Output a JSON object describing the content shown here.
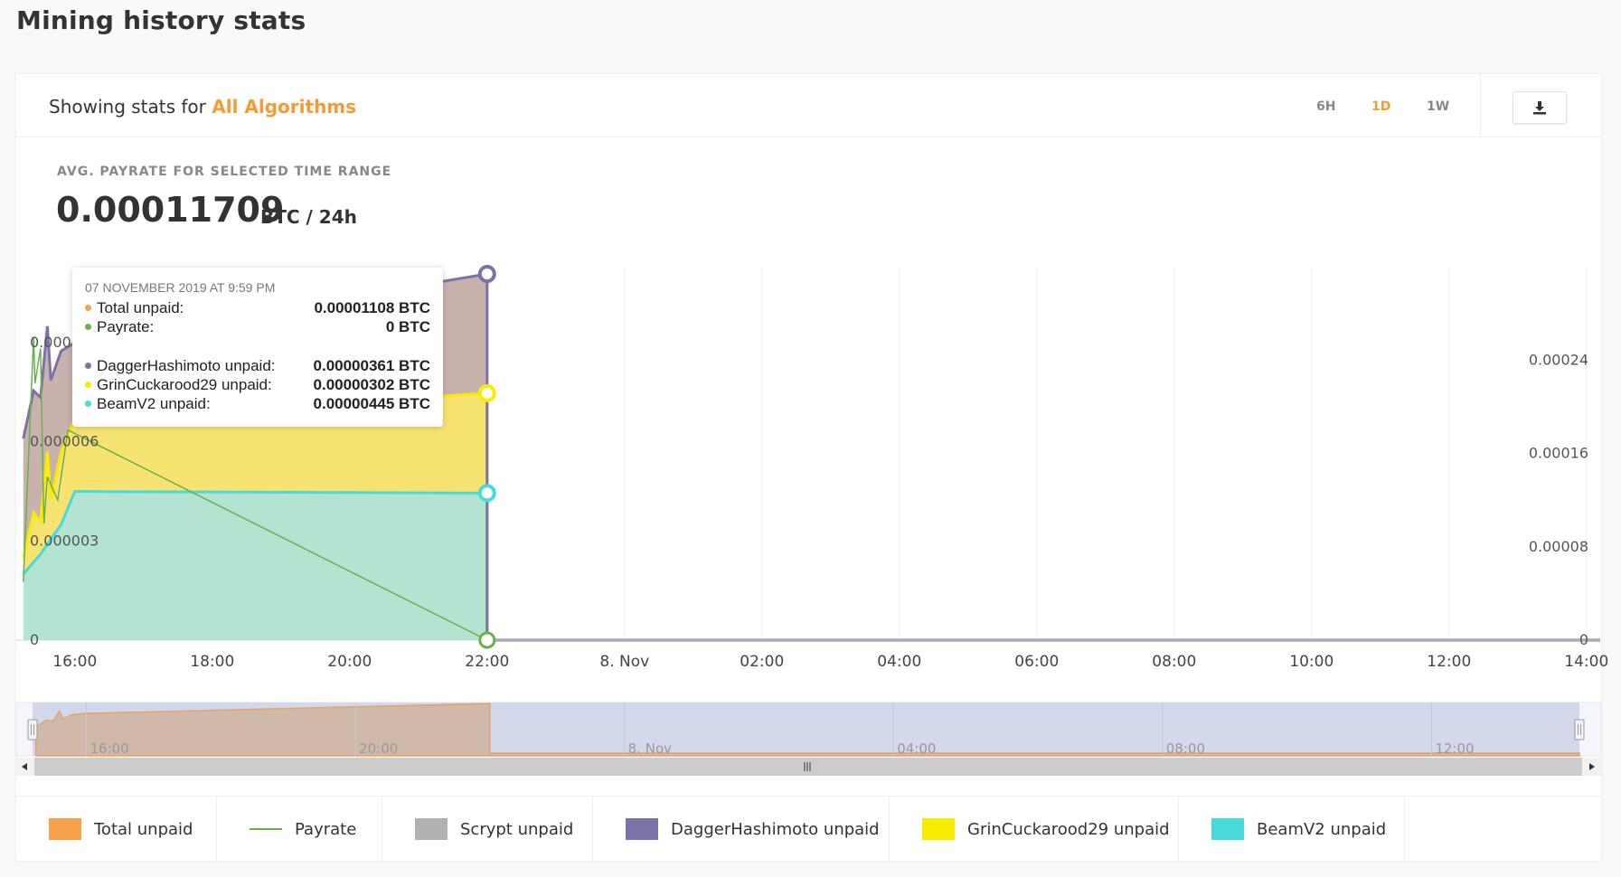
{
  "page": {
    "title": "Mining history stats"
  },
  "header": {
    "showing_prefix": "Showing stats for",
    "algorithm": "All Algorithms",
    "ranges": [
      "6H",
      "1D",
      "1W"
    ],
    "active_range": "1D",
    "download_icon": "download-icon"
  },
  "summary": {
    "label": "AVG. PAYRATE FOR SELECTED TIME RANGE",
    "value": "0.00011709",
    "unit": "BTC / 24h"
  },
  "colors": {
    "accent": "#f39c34",
    "total_unpaid": "#f7a24b",
    "payrate": "#6ab04c",
    "scrypt": "#b1b1b1",
    "dagger": "#7b73a8",
    "grin": "#f8ec00",
    "beam": "#4bd9d9",
    "dagger_fill": "#c9b1ae",
    "grin_fill": "#f7e372",
    "beam_fill": "#b3e4d2"
  },
  "tooltip": {
    "date": "07 NOVEMBER 2019 AT 9:59 PM",
    "rows": [
      {
        "label": "Total unpaid:",
        "value": "0.00001108 BTC",
        "color": "#f7a24b"
      },
      {
        "label": "Payrate:",
        "value": "0 BTC",
        "color": "#6ab04c"
      }
    ],
    "algo_rows": [
      {
        "label": "DaggerHashimoto unpaid:",
        "value": "0.00000361 BTC",
        "color": "#7b73a8"
      },
      {
        "label": "GrinCuckarood29 unpaid:",
        "value": "0.00000302 BTC",
        "color": "#f8ec00"
      },
      {
        "label": "BeamV2 unpaid:",
        "value": "0.00000445 BTC",
        "color": "#4bd9d9"
      }
    ]
  },
  "chart_data": {
    "type": "area",
    "x_tick_labels": [
      "16:00",
      "18:00",
      "20:00",
      "22:00",
      "8. Nov",
      "02:00",
      "04:00",
      "06:00",
      "08:00",
      "10:00",
      "12:00",
      "14:00"
    ],
    "x_unit": "hours since 7 Nov 00:00",
    "x_range": [
      15.2,
      38.2
    ],
    "y_left": {
      "ticks": [
        "0",
        "0.000003",
        "0.000006",
        "0.000009"
      ],
      "range": [
        0,
        1.13e-05
      ]
    },
    "y_right": {
      "ticks": [
        "0",
        "0.00008",
        "0.00016",
        "0.00024"
      ],
      "range": [
        0,
        0.00032
      ]
    },
    "stacked_series": [
      {
        "name": "BeamV2 unpaid",
        "color": "#4bd9d9",
        "x": [
          15.25,
          15.5,
          15.8,
          16.0,
          22.0,
          22.0,
          38.2
        ],
        "y": [
          2e-06,
          2.6e-06,
          3.5e-06,
          4.5e-06,
          4.45e-06,
          0.0,
          0.0
        ]
      },
      {
        "name": "GrinCuckarood29 unpaid",
        "color": "#f8ec00",
        "x": [
          15.25,
          15.4,
          15.5,
          15.6,
          15.65,
          15.8,
          16.0,
          22.0,
          22.0,
          38.2
        ],
        "y": [
          5e-07,
          1.5e-06,
          1e-06,
          2.8e-06,
          1.2e-06,
          2.2e-06,
          2.2e-06,
          3.02e-06,
          0.0,
          0.0
        ]
      },
      {
        "name": "DaggerHashimoto unpaid",
        "color": "#7b73a8",
        "x": [
          15.25,
          15.6,
          16.0,
          22.0,
          22.0,
          38.2
        ],
        "y": [
          3.6e-06,
          3.8e-06,
          2.3e-06,
          3.61e-06,
          0.0,
          0.0
        ]
      }
    ],
    "payrate_series": {
      "name": "Payrate",
      "color": "#6ab04c",
      "axis": "right",
      "x": [
        15.25,
        15.4,
        15.42,
        15.5,
        15.55,
        15.6,
        15.75,
        15.9,
        22.0,
        38.2
      ],
      "y": [
        5e-05,
        0.00026,
        0.00022,
        0.00025,
        0.0001,
        0.00014,
        0.00012,
        0.00018,
        0.0,
        0.0
      ]
    },
    "hover_x": 22.0,
    "navigator_labels": [
      "16:00",
      "20:00",
      "8. Nov",
      "04:00",
      "08:00",
      "12:00"
    ]
  },
  "legend": [
    {
      "label": "Total unpaid",
      "color": "#f7a24b",
      "kind": "box"
    },
    {
      "label": "Payrate",
      "color": "#6ab04c",
      "kind": "line"
    },
    {
      "label": "Scrypt unpaid",
      "color": "#b1b1b1",
      "kind": "box"
    },
    {
      "label": "DaggerHashimoto unpaid",
      "color": "#7b73a8",
      "kind": "box"
    },
    {
      "label": "GrinCuckarood29 unpaid",
      "color": "#f8ec00",
      "kind": "box"
    },
    {
      "label": "BeamV2 unpaid",
      "color": "#4bd9d9",
      "kind": "box"
    }
  ]
}
